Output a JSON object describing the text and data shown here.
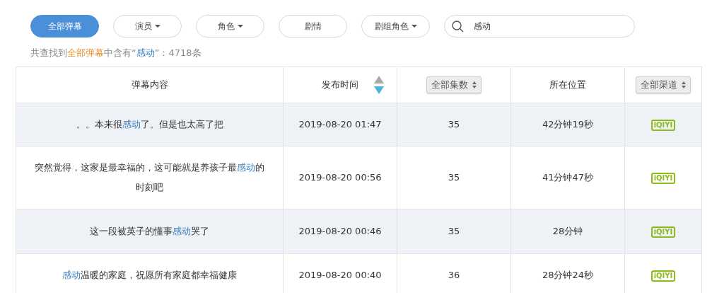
{
  "filters": [
    {
      "label": "全部弹幕",
      "selected": true,
      "dropdown": false
    },
    {
      "label": "演员",
      "selected": false,
      "dropdown": true
    },
    {
      "label": "角色",
      "selected": false,
      "dropdown": true
    },
    {
      "label": "剧情",
      "selected": false,
      "dropdown": false
    },
    {
      "label": "剧组角色",
      "selected": false,
      "dropdown": true
    }
  ],
  "search": {
    "value": "感动"
  },
  "summary": [
    {
      "text": "共查找到",
      "kind": "plain"
    },
    {
      "text": "全部弹幕",
      "kind": "accent"
    },
    {
      "text": "中含有“",
      "kind": "plain"
    },
    {
      "text": "感动",
      "kind": "highlight"
    },
    {
      "text": "”：4718条",
      "kind": "plain"
    }
  ],
  "table": {
    "columns": [
      {
        "label": "弹幕内容",
        "kind": "text"
      },
      {
        "label": "发布时间",
        "kind": "sort",
        "descending": true
      },
      {
        "label": "全部集数",
        "kind": "select"
      },
      {
        "label": "所在位置",
        "kind": "text"
      },
      {
        "label": "全部渠道",
        "kind": "select"
      }
    ],
    "rows": [
      {
        "content": [
          {
            "text": "。。本来很",
            "highlight": false
          },
          {
            "text": "感动",
            "highlight": true
          },
          {
            "text": "了。但是也太高了把",
            "highlight": false
          }
        ],
        "time": "2019-08-20 01:47",
        "episode": "35",
        "position": "42分钟19秒",
        "channel": "iQIYI"
      },
      {
        "content": [
          {
            "text": "突然觉得，这家是最幸福的，这可能就是养孩子最",
            "highlight": false
          },
          {
            "text": "感动",
            "highlight": true
          },
          {
            "text": "的时刻吧",
            "highlight": false
          }
        ],
        "time": "2019-08-20 00:56",
        "episode": "35",
        "position": "41分钟47秒",
        "channel": "iQIYI"
      },
      {
        "content": [
          {
            "text": "这一段被英子的懂事",
            "highlight": false
          },
          {
            "text": "感动",
            "highlight": true
          },
          {
            "text": "哭了",
            "highlight": false
          }
        ],
        "time": "2019-08-20 00:46",
        "episode": "35",
        "position": "28分钟",
        "channel": "iQIYI"
      },
      {
        "content": [
          {
            "text": "感动",
            "highlight": true
          },
          {
            "text": "温暖的家庭，祝愿所有家庭都幸福健康",
            "highlight": false
          }
        ],
        "time": "2019-08-20 00:40",
        "episode": "36",
        "position": "28分钟24秒",
        "channel": "iQIYI"
      }
    ]
  }
}
